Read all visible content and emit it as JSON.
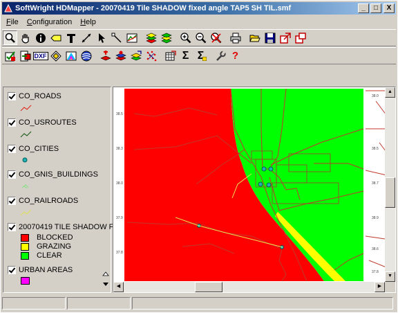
{
  "window": {
    "title": "SoftWright HDMapper - 20070419  Tile SHADOW fixed angle TAP5 SH TIL.smf",
    "minimize_label": "_",
    "maximize_label": "□",
    "close_label": "X"
  },
  "menu": [
    {
      "label": "File"
    },
    {
      "label": "Configuration"
    },
    {
      "label": "Help"
    }
  ],
  "toolbar1": [
    "zoom-window-icon",
    "pan-hand-icon",
    "info-icon",
    "label-icon",
    "text-tool-icon",
    "measure-line-icon",
    "select-arrow-icon",
    "edit-node-icon",
    "profile-icon",
    "layer-stack-icon",
    "layer-stack-green-icon",
    "zoom-in-icon",
    "zoom-out-icon",
    "zoom-full-icon",
    "print-icon",
    "open-folder-icon",
    "save-icon",
    "export-icon",
    "window-icon"
  ],
  "toolbar2": [
    "check-edit-icon",
    "import-icon",
    "dxf-icon",
    "diamond-icon",
    "rainbow-icon",
    "globe-icon",
    "add-layer-red-icon",
    "layer-red-blue-icon",
    "layer-yellow-icon",
    "scatter-points-icon",
    "table-grid-icon",
    "sum-icon",
    "sum-plus-icon",
    "wrench-icon",
    "help-icon"
  ],
  "toolbar2_text": {
    "dxf": "DXF",
    "sum": "Σ",
    "sum_plus": "Σ",
    "help": "?"
  },
  "layers": [
    {
      "name": "CO_ROADS",
      "symbol": "line",
      "color": "#e03020"
    },
    {
      "name": "CO_USROUTES",
      "symbol": "line",
      "color": "#206020"
    },
    {
      "name": "CO_CITIES",
      "symbol": "point",
      "color": "#20b0b0"
    },
    {
      "name": "CO_GNIS_BUILDINGS",
      "symbol": "faint",
      "color": "#80e080"
    },
    {
      "name": "CO_RAILROADS",
      "symbol": "line",
      "color": "#e0e060"
    },
    {
      "name": "20070419  TILE SHADOW F",
      "symbol": "none",
      "color": ""
    },
    {
      "name": "URBAN AREAS",
      "symbol": "box",
      "color": "#ff00ff"
    }
  ],
  "legend": [
    {
      "label": "BLOCKED",
      "color": "#ff0000"
    },
    {
      "label": "GRAZING",
      "color": "#ffff00"
    },
    {
      "label": "CLEAR",
      "color": "#00ff00"
    }
  ],
  "map": {
    "colors": {
      "blocked": "#ff0000",
      "grazing": "#ffff00",
      "clear": "#00ff00",
      "road": "#c0392b",
      "background": "#ffffff"
    },
    "grid_labels_right": [
      "38.0",
      "38.5",
      "38.7",
      "38.9",
      "38.6",
      "37.8"
    ],
    "grid_labels_left": [
      "38.5",
      "38.3",
      "38.0",
      "37.9",
      "37.8"
    ]
  }
}
